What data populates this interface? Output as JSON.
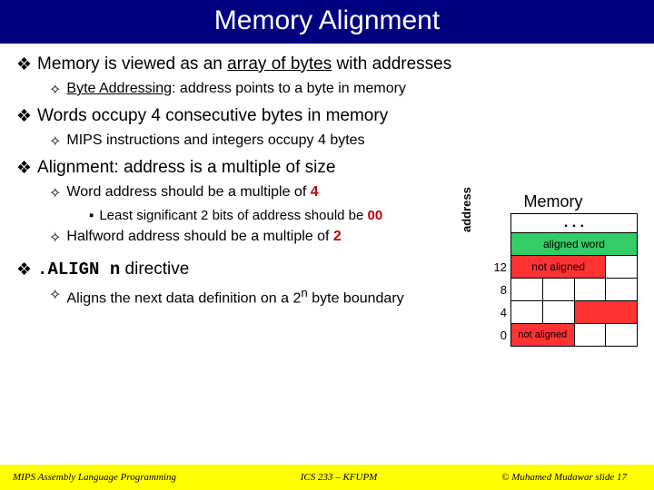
{
  "title": "Memory Alignment",
  "p1_a": "Memory is viewed as an ",
  "p1_b": "array of bytes",
  "p1_c": " with addresses",
  "p1_1_a": "Byte Addressing",
  "p1_1_b": ": address points to a byte in memory",
  "p2": "Words occupy 4 consecutive bytes in memory",
  "p2_1": "MIPS instructions and integers occupy 4 bytes",
  "p3": "Alignment: address is a multiple of size",
  "p3_1_a": "Word address should be a multiple of ",
  "p3_1_b": "4",
  "p3_1_1_a": "Least significant 2 bits of address should be ",
  "p3_1_1_b": "00",
  "p3_2_a": "Halfword address should be a multiple of ",
  "p3_2_b": "2",
  "p4_a": ".ALIGN n",
  "p4_b": " directive",
  "p4_1_a": "Aligns the next data definition on a 2",
  "p4_1_n": "n",
  "p4_1_b": " byte boundary",
  "mem": {
    "heading": "Memory",
    "addrlabel": "address",
    "dots": ". . .",
    "aligned_label": "aligned word",
    "not_aligned_label": "not aligned",
    "addrs": [
      "12",
      "8",
      "4",
      "0"
    ]
  },
  "footer": {
    "left": "MIPS Assembly Language Programming",
    "center": "ICS 233 – KFUPM",
    "right": "© Muhamed Mudawar   slide 17"
  }
}
